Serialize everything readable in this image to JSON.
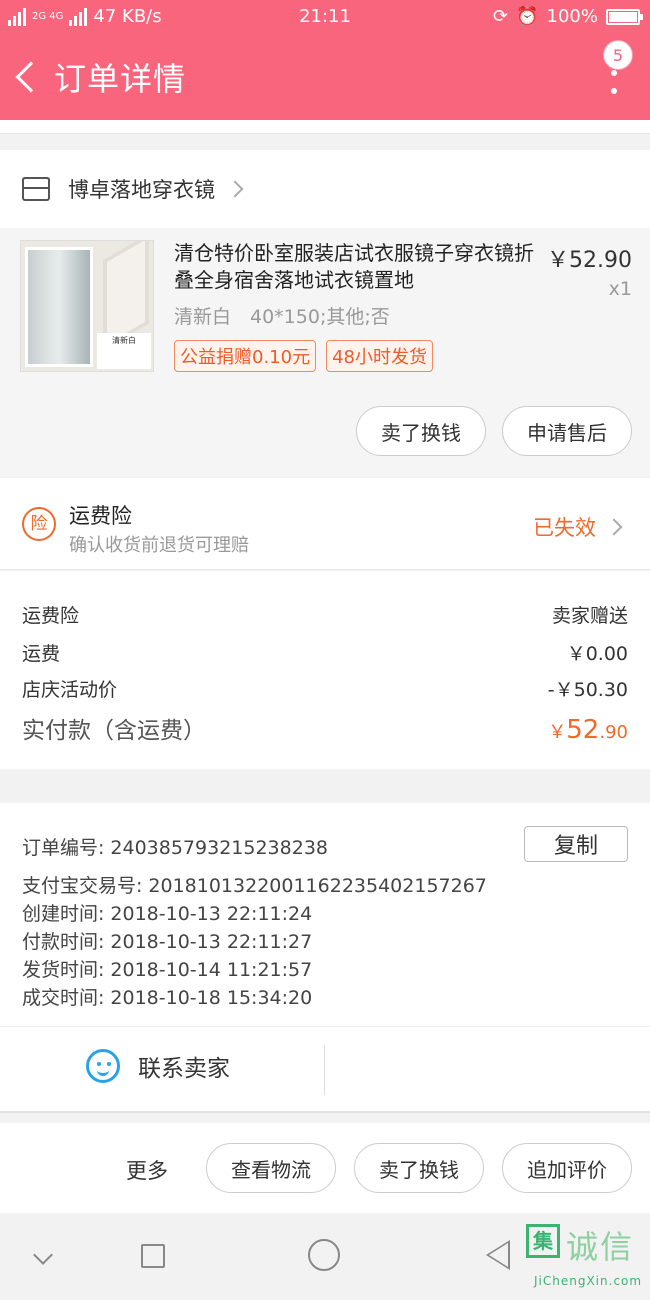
{
  "status_bar": {
    "network": "2G 4G",
    "speed": "47 KB/s",
    "time": "21:11",
    "battery": "100%",
    "battery_level": 1.0
  },
  "nav": {
    "title": "订单详情",
    "badge": "5",
    "color": "#f9657c"
  },
  "shop": {
    "name": "博卓落地穿衣镜"
  },
  "product": {
    "image_tag": "清新白",
    "title": "清仓特价卧室服装店试衣服镜子穿衣镜折叠全身宿舍落地试衣镜置地",
    "price": "￥52.90",
    "qty": "x1",
    "spec": "清新白　40*150;其他;否",
    "tags": [
      "公益捐赠0.10元",
      "48小时发货"
    ],
    "actions": [
      "卖了换钱",
      "申请售后"
    ]
  },
  "insurance": {
    "title": "运费险",
    "subtitle": "确认收货前退货可理赔",
    "status": "已失效",
    "icon_char": "险"
  },
  "fees": [
    {
      "label": "运费险",
      "value": "卖家赠送"
    },
    {
      "label": "运费",
      "value": "￥0.00"
    },
    {
      "label": "店庆活动价",
      "value": "-￥50.30"
    }
  ],
  "total": {
    "label": "实付款（含运费）",
    "currency": "￥",
    "integer": "52",
    "decimal": ".90"
  },
  "order_info": {
    "copy_label": "复制",
    "rows": [
      {
        "label": "订单编号:",
        "value": "240385793215238238"
      },
      {
        "label": "支付宝交易号:",
        "value": "2018101322001162235402157267"
      },
      {
        "label": "创建时间:",
        "value": "2018-10-13 22:11:24"
      },
      {
        "label": "付款时间:",
        "value": "2018-10-13 22:11:27"
      },
      {
        "label": "发货时间:",
        "value": "2018-10-14 11:21:57"
      },
      {
        "label": "成交时间:",
        "value": "2018-10-18 15:34:20"
      }
    ]
  },
  "contact": {
    "label": "联系卖家"
  },
  "footer": {
    "more": "更多",
    "actions": [
      "查看物流",
      "卖了换钱",
      "追加评价"
    ]
  },
  "watermark": {
    "box": "集",
    "text": "诚信",
    "url": "JiChengXin.com"
  }
}
